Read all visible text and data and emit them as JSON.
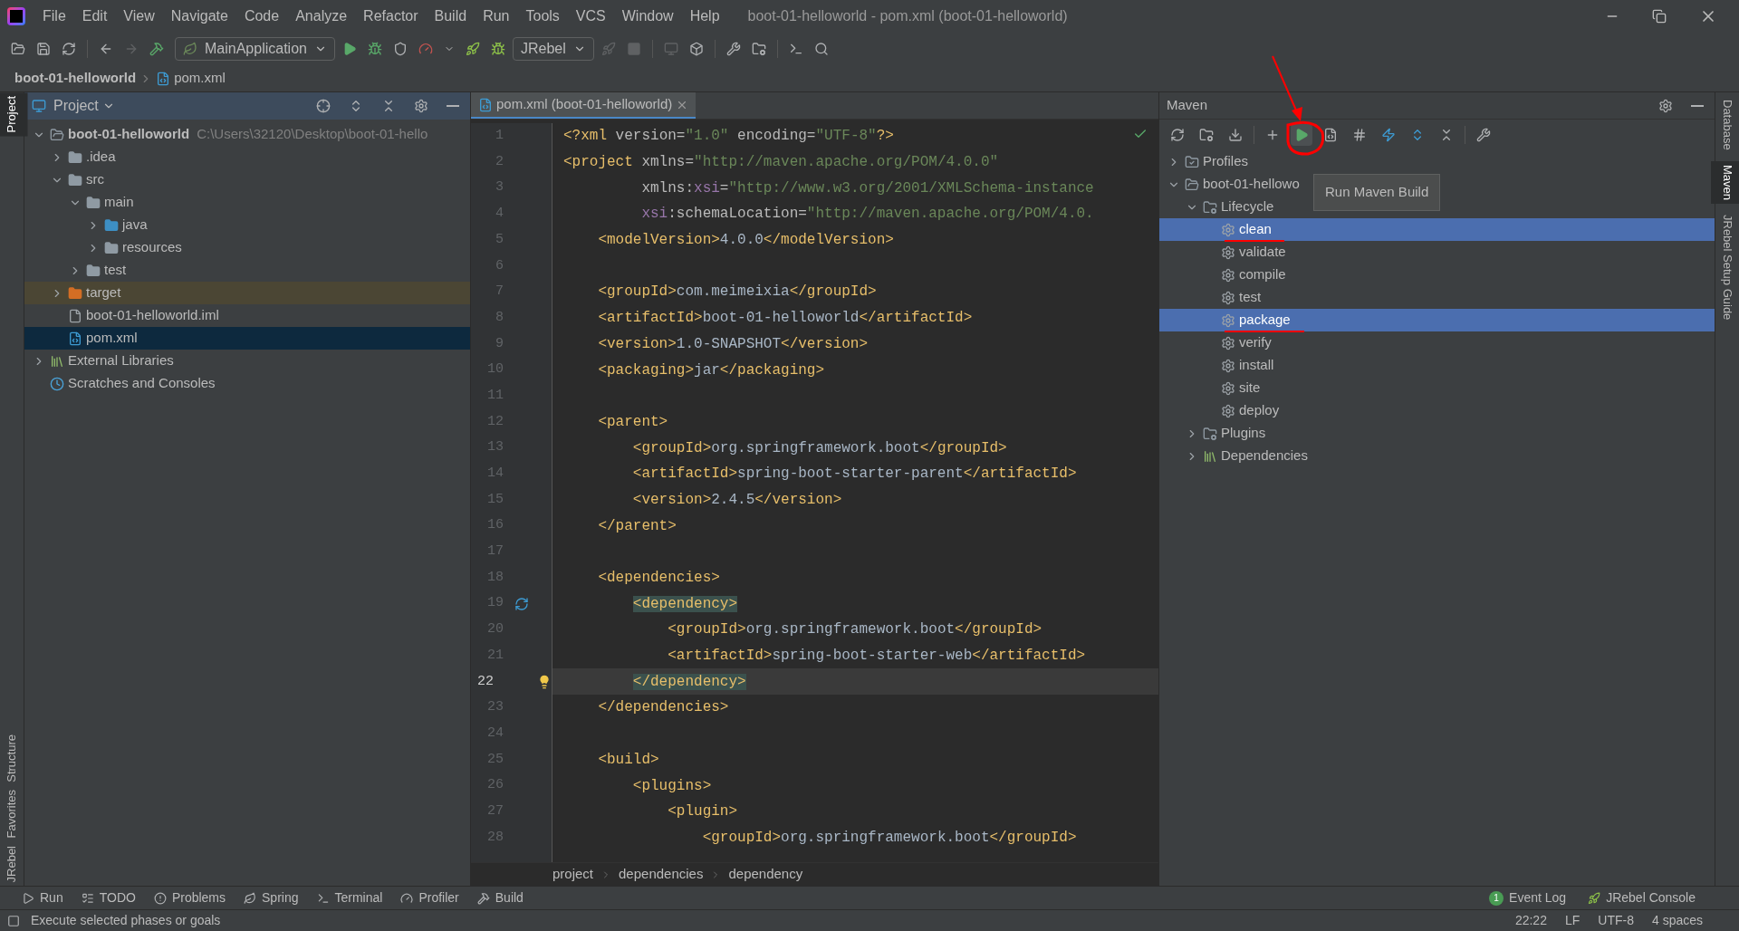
{
  "window": {
    "title": "boot-01-helloworld - pom.xml (boot-01-helloworld)"
  },
  "menu": [
    "File",
    "Edit",
    "View",
    "Navigate",
    "Code",
    "Analyze",
    "Refactor",
    "Build",
    "Run",
    "Tools",
    "VCS",
    "Window",
    "Help"
  ],
  "toolbar": {
    "run_config": "MainApplication",
    "jrebel": "JRebel"
  },
  "breadcrumb": [
    "boot-01-helloworld",
    "pom.xml"
  ],
  "left_strip": [
    {
      "label": "Project",
      "selected": true
    },
    {
      "label": "Structure",
      "selected": false
    },
    {
      "label": "Favorites",
      "selected": false
    },
    {
      "label": "JRebel",
      "selected": false
    }
  ],
  "project": {
    "title": "Project",
    "tree": [
      {
        "label": "boot-01-helloworld",
        "path": "C:\\Users\\32120\\Desktop\\boot-01-hello",
        "kind": "module",
        "expanded": true,
        "selected": false,
        "children": [
          {
            "label": ".idea",
            "kind": "folder",
            "expanded": false,
            "selected": false
          },
          {
            "label": "src",
            "kind": "folder",
            "expanded": true,
            "selected": false,
            "children": [
              {
                "label": "main",
                "kind": "folder",
                "expanded": true,
                "selected": false,
                "children": [
                  {
                    "label": "java",
                    "kind": "source",
                    "expanded": false,
                    "selected": false
                  },
                  {
                    "label": "resources",
                    "kind": "resources",
                    "expanded": false,
                    "selected": false
                  }
                ]
              },
              {
                "label": "test",
                "kind": "folder",
                "expanded": false,
                "selected": false
              }
            ]
          },
          {
            "label": "target",
            "kind": "excluded",
            "expanded": false,
            "selected": false
          },
          {
            "label": "boot-01-helloworld.iml",
            "kind": "file",
            "selected": false
          },
          {
            "label": "pom.xml",
            "kind": "maven",
            "selected": true
          }
        ]
      },
      {
        "label": "External Libraries",
        "kind": "library",
        "expanded": false,
        "selected": false
      },
      {
        "label": "Scratches and Consoles",
        "kind": "scratch",
        "selected": false
      }
    ]
  },
  "editor": {
    "tab": "pom.xml (boot-01-helloworld)",
    "lines": [
      {
        "num": "1",
        "current": false,
        "segs": [
          {
            "kind": "tag",
            "text": "<?xml"
          },
          {
            "kind": "attr",
            "text": " version="
          },
          {
            "kind": "str",
            "text": "\"1.0\""
          },
          {
            "kind": "attr",
            "text": " encoding="
          },
          {
            "kind": "str",
            "text": "\"UTF-8\""
          },
          {
            "kind": "tag",
            "text": "?>"
          }
        ]
      },
      {
        "num": "2",
        "current": false,
        "segs": [
          {
            "kind": "tag",
            "text": "<project"
          },
          {
            "kind": "attr",
            "text": " xmlns="
          },
          {
            "kind": "str",
            "text": "\"http://maven.apache.org/POM/4.0.0\""
          }
        ]
      },
      {
        "num": "3",
        "current": false,
        "segs": [
          {
            "kind": "attr",
            "text": "         xmlns:"
          },
          {
            "kind": "ns",
            "text": "xsi"
          },
          {
            "kind": "attr",
            "text": "="
          },
          {
            "kind": "str",
            "text": "\"http://www.w3.org/2001/XMLSchema-instance"
          }
        ]
      },
      {
        "num": "4",
        "current": false,
        "segs": [
          {
            "kind": "ns",
            "text": "         xsi"
          },
          {
            "kind": "attr",
            "text": ":schemaLocation="
          },
          {
            "kind": "str",
            "text": "\"http://maven.apache.org/POM/4.0."
          }
        ]
      },
      {
        "num": "5",
        "current": false,
        "segs": [
          {
            "kind": "tag",
            "text": "    <modelVersion>"
          },
          {
            "kind": "text",
            "text": "4.0.0"
          },
          {
            "kind": "tag",
            "text": "</modelVersion>"
          }
        ]
      },
      {
        "num": "6",
        "current": false
      },
      {
        "num": "7",
        "current": false,
        "segs": [
          {
            "kind": "tag",
            "text": "    <groupId>"
          },
          {
            "kind": "text",
            "text": "com.meimeixia"
          },
          {
            "kind": "tag",
            "text": "</groupId>"
          }
        ]
      },
      {
        "num": "8",
        "current": false,
        "segs": [
          {
            "kind": "tag",
            "text": "    <artifactId>"
          },
          {
            "kind": "text",
            "text": "boot-01-helloworld"
          },
          {
            "kind": "tag",
            "text": "</artifactId>"
          }
        ]
      },
      {
        "num": "9",
        "current": false,
        "segs": [
          {
            "kind": "tag",
            "text": "    <version>"
          },
          {
            "kind": "text",
            "text": "1.0-SNAPSHOT"
          },
          {
            "kind": "tag",
            "text": "</version>"
          }
        ]
      },
      {
        "num": "10",
        "current": false,
        "segs": [
          {
            "kind": "tag",
            "text": "    <packaging>"
          },
          {
            "kind": "text",
            "text": "jar"
          },
          {
            "kind": "tag",
            "text": "</packaging>"
          }
        ]
      },
      {
        "num": "11",
        "current": false
      },
      {
        "num": "12",
        "current": false,
        "segs": [
          {
            "kind": "tag",
            "text": "    <parent>"
          }
        ]
      },
      {
        "num": "13",
        "current": false,
        "segs": [
          {
            "kind": "tag",
            "text": "        <groupId>"
          },
          {
            "kind": "text",
            "text": "org.springframework.boot"
          },
          {
            "kind": "tag",
            "text": "</groupId>"
          }
        ]
      },
      {
        "num": "14",
        "current": false,
        "segs": [
          {
            "kind": "tag",
            "text": "        <artifactId>"
          },
          {
            "kind": "text",
            "text": "spring-boot-starter-parent"
          },
          {
            "kind": "tag",
            "text": "</artifactId>"
          }
        ]
      },
      {
        "num": "15",
        "current": false,
        "segs": [
          {
            "kind": "tag",
            "text": "        <version>"
          },
          {
            "kind": "text",
            "text": "2.4.5"
          },
          {
            "kind": "tag",
            "text": "</version>"
          }
        ]
      },
      {
        "num": "16",
        "current": false,
        "segs": [
          {
            "kind": "tag",
            "text": "    </parent>"
          }
        ]
      },
      {
        "num": "17",
        "current": false
      },
      {
        "num": "18",
        "current": false,
        "segs": [
          {
            "kind": "tag",
            "text": "    <dependencies>"
          }
        ]
      },
      {
        "num": "19",
        "current": false,
        "segs": [
          {
            "kind": "match",
            "text": "        <dependency>"
          }
        ]
      },
      {
        "num": "20",
        "current": false,
        "segs": [
          {
            "kind": "tag",
            "text": "            <groupId>"
          },
          {
            "kind": "text",
            "text": "org.springframework.boot"
          },
          {
            "kind": "tag",
            "text": "</groupId>"
          }
        ]
      },
      {
        "num": "21",
        "current": false,
        "segs": [
          {
            "kind": "tag",
            "text": "            <artifactId>"
          },
          {
            "kind": "text",
            "text": "spring-boot-starter-web"
          },
          {
            "kind": "tag",
            "text": "</artifactId>"
          }
        ]
      },
      {
        "num": "22",
        "current": true,
        "segs": [
          {
            "kind": "match",
            "text": "        </dependency>"
          }
        ]
      },
      {
        "num": "23",
        "current": false,
        "segs": [
          {
            "kind": "tag",
            "text": "    </dependencies>"
          }
        ]
      },
      {
        "num": "24",
        "current": false
      },
      {
        "num": "25",
        "current": false,
        "segs": [
          {
            "kind": "tag",
            "text": "    <build>"
          }
        ]
      },
      {
        "num": "26",
        "current": false,
        "segs": [
          {
            "kind": "tag",
            "text": "        <plugins>"
          }
        ]
      },
      {
        "num": "27",
        "current": false,
        "segs": [
          {
            "kind": "tag",
            "text": "            <plugin>"
          }
        ]
      },
      {
        "num": "28",
        "current": false,
        "segs": [
          {
            "kind": "tag",
            "text": "                <groupId>"
          },
          {
            "kind": "text",
            "text": "org.springframework.boot"
          },
          {
            "kind": "tag",
            "text": "</groupId>"
          }
        ]
      }
    ],
    "breadcrumb": [
      "project",
      "dependencies",
      "dependency"
    ]
  },
  "maven": {
    "title": "Maven",
    "tooltip": "Run Maven Build",
    "tree": [
      {
        "label": "Profiles",
        "kind": "profiles",
        "expanded": false,
        "selected": false
      },
      {
        "label": "boot-01-hellowo",
        "kind": "module",
        "expanded": true,
        "selected": false,
        "children": [
          {
            "label": "Lifecycle",
            "kind": "lifecycle",
            "expanded": true,
            "selected": false,
            "children": [
              {
                "label": "clean",
                "kind": "goal",
                "selected": true
              },
              {
                "label": "validate",
                "kind": "goal",
                "selected": false
              },
              {
                "label": "compile",
                "kind": "goal",
                "selected": false
              },
              {
                "label": "test",
                "kind": "goal",
                "selected": false
              },
              {
                "label": "package",
                "kind": "goal",
                "selected": true
              },
              {
                "label": "verify",
                "kind": "goal",
                "selected": false
              },
              {
                "label": "install",
                "kind": "goal",
                "selected": false
              },
              {
                "label": "site",
                "kind": "goal",
                "selected": false
              },
              {
                "label": "deploy",
                "kind": "goal",
                "selected": false
              }
            ]
          },
          {
            "label": "Plugins",
            "kind": "lifecycle",
            "expanded": false,
            "selected": false
          },
          {
            "label": "Dependencies",
            "kind": "library",
            "expanded": false,
            "selected": false
          }
        ]
      }
    ]
  },
  "right_strip": [
    {
      "label": "Database",
      "selected": false
    },
    {
      "label": "Maven",
      "selected": true
    },
    {
      "label": "JRebel Setup Guide",
      "selected": false
    }
  ],
  "tool_windows": [
    "Run",
    "TODO",
    "Problems",
    "Spring",
    "Terminal",
    "Profiler",
    "Build"
  ],
  "tool_windows_right": [
    {
      "label": "Event Log",
      "badge": "1"
    },
    {
      "label": "JRebel Console"
    }
  ],
  "status_bar": {
    "message": "Execute selected phases or goals",
    "items": [
      "22:22",
      "LF",
      "UTF-8",
      "4 spaces"
    ]
  }
}
